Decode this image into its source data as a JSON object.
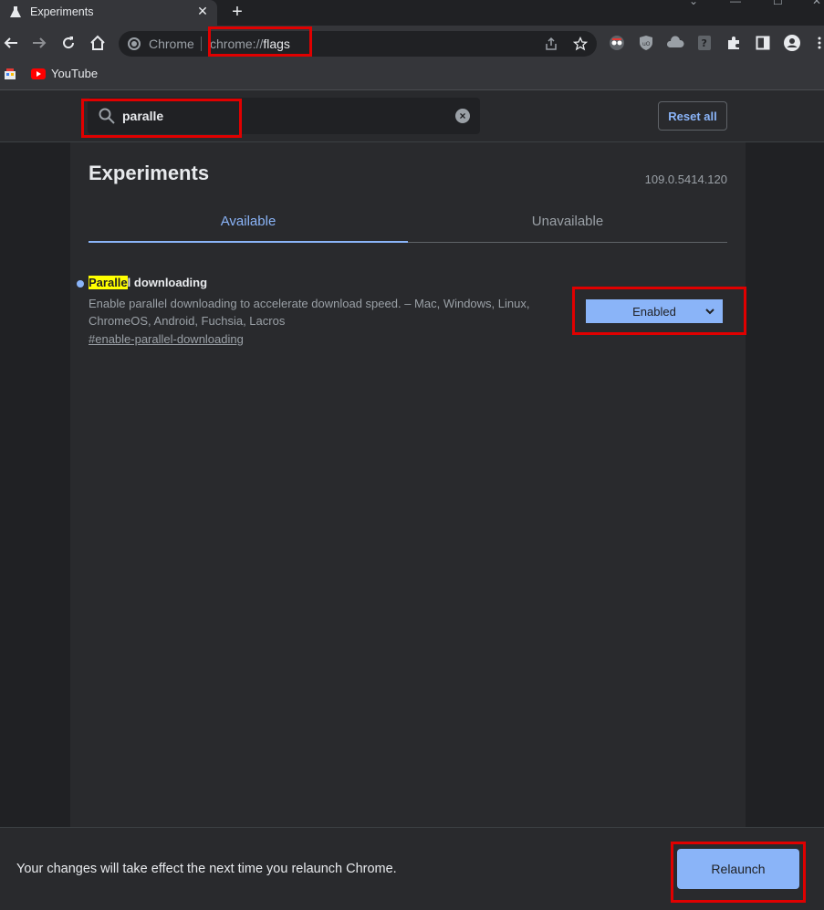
{
  "browser": {
    "tab_title": "Experiments",
    "tab_close": "✕",
    "new_tab": "+",
    "omnibox_chip": "Chrome",
    "url_scheme": "chrome://",
    "url_host": "flags",
    "bookmarks": [
      {
        "label": "YouTube"
      }
    ]
  },
  "header": {
    "search_value": "paralle",
    "search_placeholder": "Search flags",
    "reset_label": "Reset all"
  },
  "page": {
    "title": "Experiments",
    "version": "109.0.5414.120",
    "tabs": [
      {
        "label": "Available",
        "active": true
      },
      {
        "label": "Unavailable",
        "active": false
      }
    ]
  },
  "flags": [
    {
      "name_highlight": "Paralle",
      "name_rest": "l downloading",
      "description": "Enable parallel downloading to accelerate download speed. – Mac, Windows, Linux, ChromeOS, Android, Fuchsia, Lacros",
      "link": "#enable-parallel-downloading",
      "state": "Enabled"
    }
  ],
  "bottom": {
    "message": "Your changes will take effect the next time you relaunch Chrome.",
    "relaunch_label": "Relaunch"
  },
  "colors": {
    "accent": "#8ab4f8",
    "highlight": "#ffff00",
    "annotation": "#e00000"
  }
}
